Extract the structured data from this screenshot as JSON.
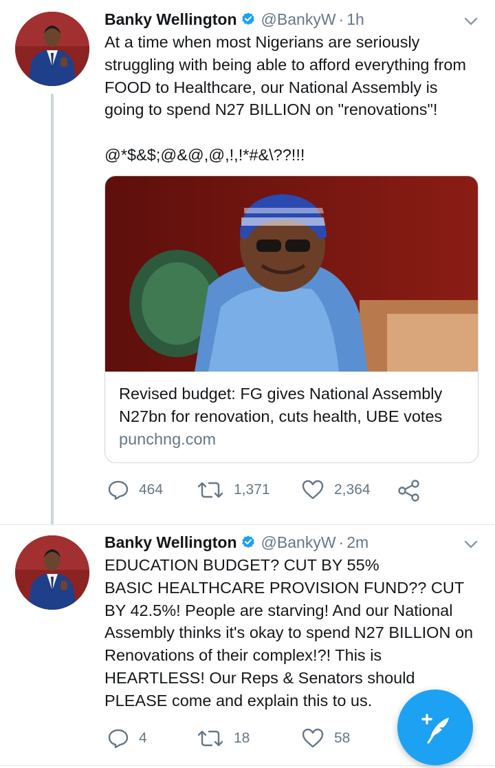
{
  "tweets": [
    {
      "author_name": "Banky Wellington",
      "handle": "@BankyW",
      "separator": "·",
      "time": "1h",
      "text": "At a time when most Nigerians are seriously struggling with being able to afford everything from FOOD to Healthcare, our National Assembly is going to spend N27 BILLION on \"renovations\"!\n\n@*$&$;@&@,@,!,!*#&\\??!!!",
      "card": {
        "title": "Revised budget: FG gives National Assembly N27bn for renovation, cuts health, UBE votes",
        "domain": "punchng.com"
      },
      "replies": "464",
      "retweets": "1,371",
      "likes": "2,364"
    },
    {
      "author_name": "Banky Wellington",
      "handle": "@BankyW",
      "separator": "·",
      "time": "2m",
      "text": "EDUCATION BUDGET? CUT BY 55%\nBASIC HEALTHCARE PROVISION FUND?? CUT BY 42.5%! People are starving! And our National Assembly thinks it's okay to spend N27 BILLION on Renovations of their complex!?! This is HEARTLESS! Our Reps & Senators should PLEASE come and explain this to us.",
      "replies": "4",
      "retweets": "18",
      "likes": "58"
    }
  ],
  "icons": {
    "verified": "verified-badge-icon",
    "caret": "chevron-down-icon",
    "reply": "reply-icon",
    "retweet": "retweet-icon",
    "like": "heart-icon",
    "share": "share-icon",
    "compose": "compose-tweet-icon"
  },
  "colors": {
    "accent": "#1da1f2",
    "text": "#14171a",
    "secondary": "#657786",
    "border": "#ccd6dd"
  }
}
